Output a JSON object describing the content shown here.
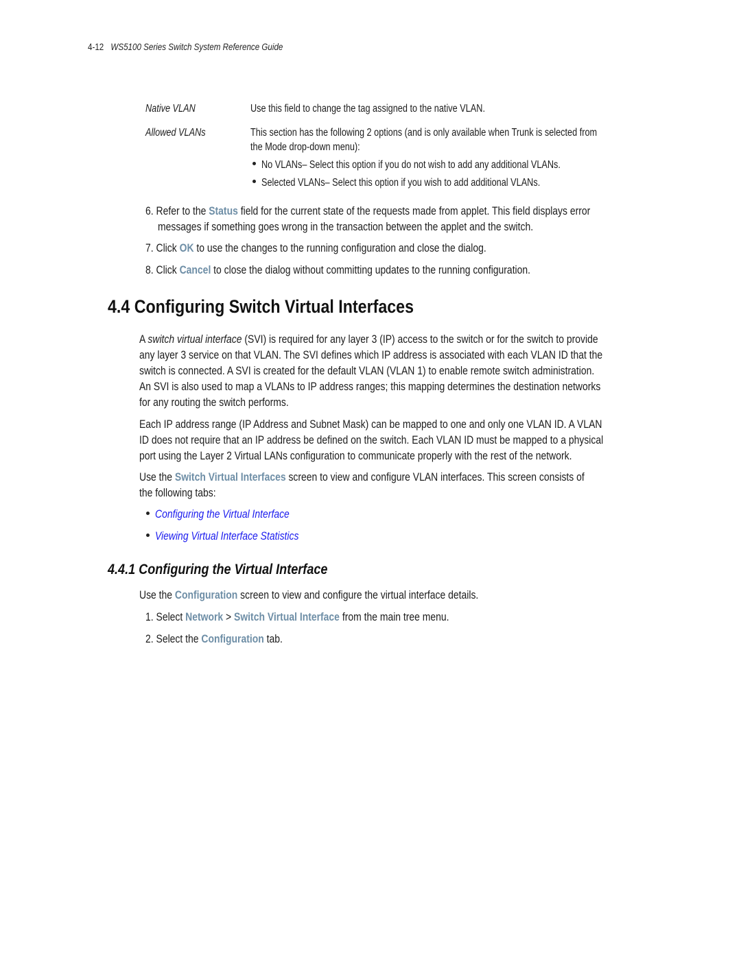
{
  "header": {
    "page_number": "4-12",
    "guide_title": "WS5100 Series Switch System Reference Guide"
  },
  "field_table": [
    {
      "term": "Native VLAN",
      "description": "Use this field to change the tag assigned to the native VLAN."
    },
    {
      "term": "Allowed VLANs",
      "description_line1": "This section has the following 2 options (and is only available when Trunk is selected from",
      "description_line2": "the Mode drop-down menu):",
      "bullets": [
        "No VLANs– Select this option if you do not wish to add any additional VLANs.",
        "Selected VLANs– Select this option if you wish to add additional VLANs."
      ]
    }
  ],
  "steps_a": [
    {
      "num": "6.",
      "pre": "Refer to the ",
      "kw": "Status",
      "post": " field for the current state of the requests made from applet. This field displays error",
      "line2": "messages if something goes wrong in the transaction between the applet and the switch."
    },
    {
      "num": "7.",
      "pre": "Click ",
      "kw": "OK",
      "post": " to use the changes to the running configuration and close the dialog."
    },
    {
      "num": "8.",
      "pre": "Click ",
      "kw": "Cancel",
      "post": " to close the dialog without committing updates to the running configuration."
    }
  ],
  "section_4_4": {
    "title": "4.4  Configuring Switch Virtual Interfaces",
    "para1": {
      "line1_pre": "A ",
      "line1_term": "switch virtual interface",
      "line1_post": " (SVI) is required for any layer 3 (IP) access to the switch or for the switch to provide",
      "line2": "any layer 3 service on that VLAN. The SVI defines which IP address is associated with each VLAN ID that the",
      "line3": "switch is connected. A SVI is created for the default VLAN (VLAN 1) to enable remote switch administration.",
      "line4": "An SVI is also used to map a VLANs to IP address ranges; this mapping determines the destination networks",
      "line5": "for any routing the switch performs."
    },
    "para2": {
      "line1": "Each IP address range (IP Address and Subnet Mask) can be mapped to one and only one VLAN ID. A VLAN",
      "line2": "ID does not require that an IP address be defined on the switch. Each VLAN ID must be mapped to a physical",
      "line3": "port using the Layer 2 Virtual LANs configuration to communicate properly with the rest of the network."
    },
    "para3": {
      "pre": "Use the ",
      "kw": "Switch Virtual Interfaces",
      "post": " screen to view and configure VLAN interfaces. This screen consists of",
      "line2": "the following tabs:"
    },
    "links": [
      "Configuring the Virtual Interface",
      "Viewing Virtual Interface Statistics"
    ]
  },
  "section_4_4_1": {
    "title": "4.4.1  Configuring the Virtual Interface",
    "intro": {
      "pre": "Use the ",
      "kw": "Configuration",
      "post": " screen to view and configure the virtual interface details."
    },
    "steps": [
      {
        "num": "1.",
        "pre": "Select ",
        "kw1": "Network",
        "sep": " > ",
        "kw2": "Switch Virtual Interface",
        "post": " from the main tree menu."
      },
      {
        "num": "2.",
        "pre": "Select the ",
        "kw": "Configuration",
        "post": " tab."
      }
    ]
  },
  "colors": {
    "keyword": "#6e8ea6",
    "link": "#1a1aee",
    "text": "#1c1c1c"
  }
}
